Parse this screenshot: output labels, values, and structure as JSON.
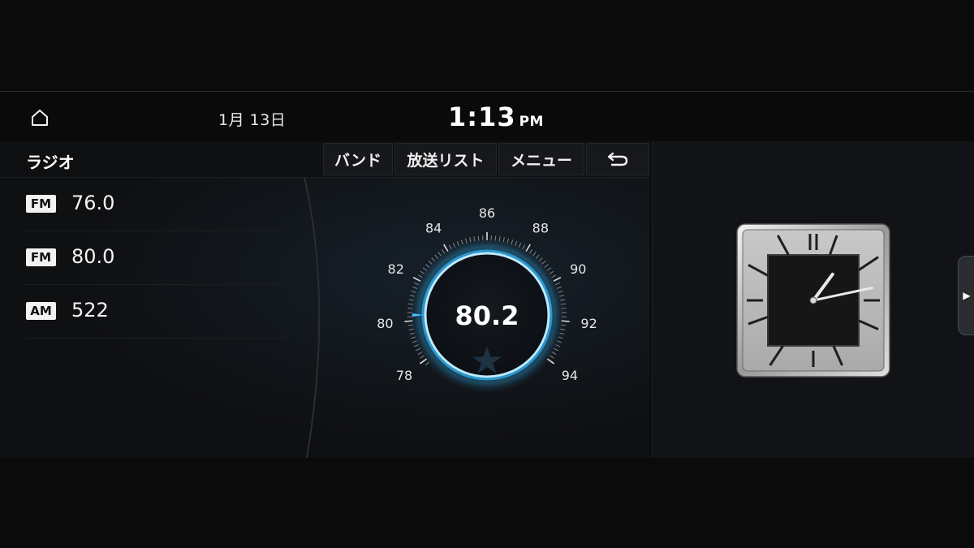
{
  "status": {
    "date": "1月 13日",
    "time": "1:13",
    "ampm": "PM"
  },
  "panel": {
    "title": "ラジオ",
    "buttons": {
      "band": "バンド",
      "station_list": "放送リスト",
      "menu": "メニュー",
      "back_icon": "back-arrow-icon"
    }
  },
  "presets": [
    {
      "band": "FM",
      "freq": "76.0"
    },
    {
      "band": "FM",
      "freq": "80.0"
    },
    {
      "band": "AM",
      "freq": "522"
    }
  ],
  "tuner": {
    "current_freq": "80.2",
    "scale_labels": [
      "78",
      "80",
      "82",
      "84",
      "86",
      "88",
      "90",
      "92",
      "94"
    ],
    "favorite_icon": "star-icon"
  },
  "clock_widget": {
    "hour": 1,
    "minute": 13
  },
  "colors": {
    "accent": "#2fa6e0",
    "background": "#0c0d0e"
  }
}
